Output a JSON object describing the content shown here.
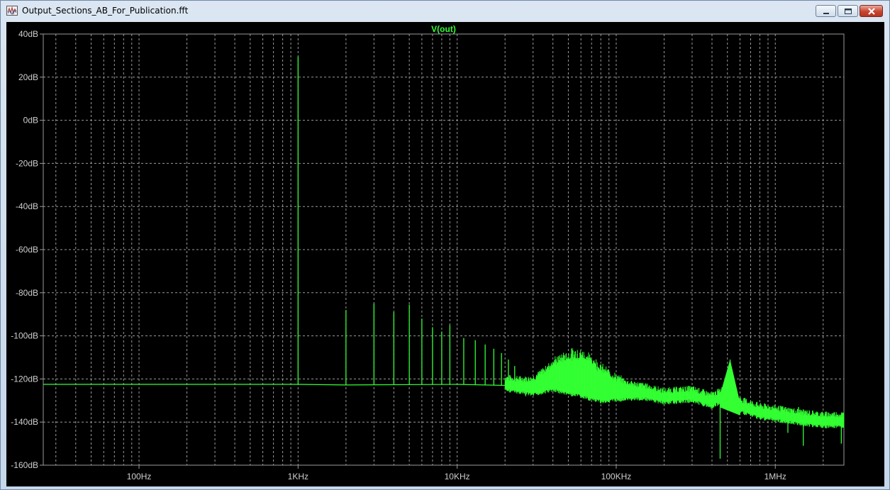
{
  "window": {
    "title": "Output_Sections_AB_For_Publication.fft",
    "icon": "waveform-viewer-icon",
    "controls": [
      "minimize-icon",
      "maximize-icon",
      "close-icon"
    ]
  },
  "colors": {
    "background": "#000000",
    "trace": "#33ff33",
    "grid": "#9a9a9a",
    "axis_text": "#cfcfcf"
  },
  "chart_data": {
    "type": "line",
    "title": "V(out)",
    "x_scale": "log",
    "xlim": [
      25,
      2700000
    ],
    "ylim": [
      -160,
      40
    ],
    "y_unit": "dB",
    "grid": true,
    "x_ticks": [
      {
        "value": 100,
        "label": "100Hz"
      },
      {
        "value": 1000,
        "label": "1KHz"
      },
      {
        "value": 10000,
        "label": "10KHz"
      },
      {
        "value": 100000,
        "label": "100KHz"
      },
      {
        "value": 1000000,
        "label": "1MHz"
      }
    ],
    "y_ticks": [
      {
        "value": 40,
        "label": "40dB"
      },
      {
        "value": 20,
        "label": "20dB"
      },
      {
        "value": 0,
        "label": "0dB"
      },
      {
        "value": -20,
        "label": "-20dB"
      },
      {
        "value": -40,
        "label": "-40dB"
      },
      {
        "value": -60,
        "label": "-60dB"
      },
      {
        "value": -80,
        "label": "-80dB"
      },
      {
        "value": -100,
        "label": "-100dB"
      },
      {
        "value": -120,
        "label": "-120dB"
      },
      {
        "value": -140,
        "label": "-140dB"
      },
      {
        "value": -160,
        "label": "-160dB"
      }
    ],
    "series": [
      {
        "name": "V(out)",
        "noise_floor": [
          [
            25,
            -122.5
          ],
          [
            1000,
            -122.5
          ],
          [
            2000,
            -122.8
          ],
          [
            10000,
            -122.5
          ],
          [
            20000,
            -123
          ],
          [
            30000,
            -125
          ],
          [
            40000,
            -122
          ],
          [
            60000,
            -124
          ],
          [
            80000,
            -127
          ],
          [
            100000,
            -127
          ],
          [
            150000,
            -127
          ],
          [
            200000,
            -129
          ],
          [
            300000,
            -128
          ],
          [
            400000,
            -131
          ],
          [
            500000,
            -127
          ],
          [
            600000,
            -133
          ],
          [
            800000,
            -136
          ],
          [
            1000000,
            -137
          ],
          [
            1500000,
            -139
          ],
          [
            2000000,
            -140
          ],
          [
            2700000,
            -140
          ]
        ],
        "peaks": [
          [
            1000,
            29.5
          ],
          [
            2000,
            -88
          ],
          [
            3000,
            -85
          ],
          [
            4000,
            -89
          ],
          [
            5000,
            -85.5
          ],
          [
            6000,
            -92
          ],
          [
            7000,
            -96
          ],
          [
            8000,
            -98
          ],
          [
            9000,
            -95
          ],
          [
            11000,
            -101
          ],
          [
            13000,
            -102
          ],
          [
            15000,
            -104
          ],
          [
            17000,
            -106
          ],
          [
            19000,
            -108
          ],
          [
            21000,
            -111
          ],
          [
            23000,
            -114
          ],
          [
            60000,
            -110
          ],
          [
            520000,
            -111
          ],
          [
            620000,
            -135
          ],
          [
            1250000,
            -134
          ],
          [
            1400000,
            -133
          ]
        ],
        "dips": [
          [
            27000,
            -128
          ],
          [
            35000,
            -126
          ],
          [
            62000,
            -129
          ],
          [
            140000,
            -130
          ],
          [
            450000,
            -157
          ],
          [
            1200000,
            -145
          ],
          [
            1500000,
            -151
          ],
          [
            2600000,
            -150
          ]
        ]
      }
    ]
  }
}
